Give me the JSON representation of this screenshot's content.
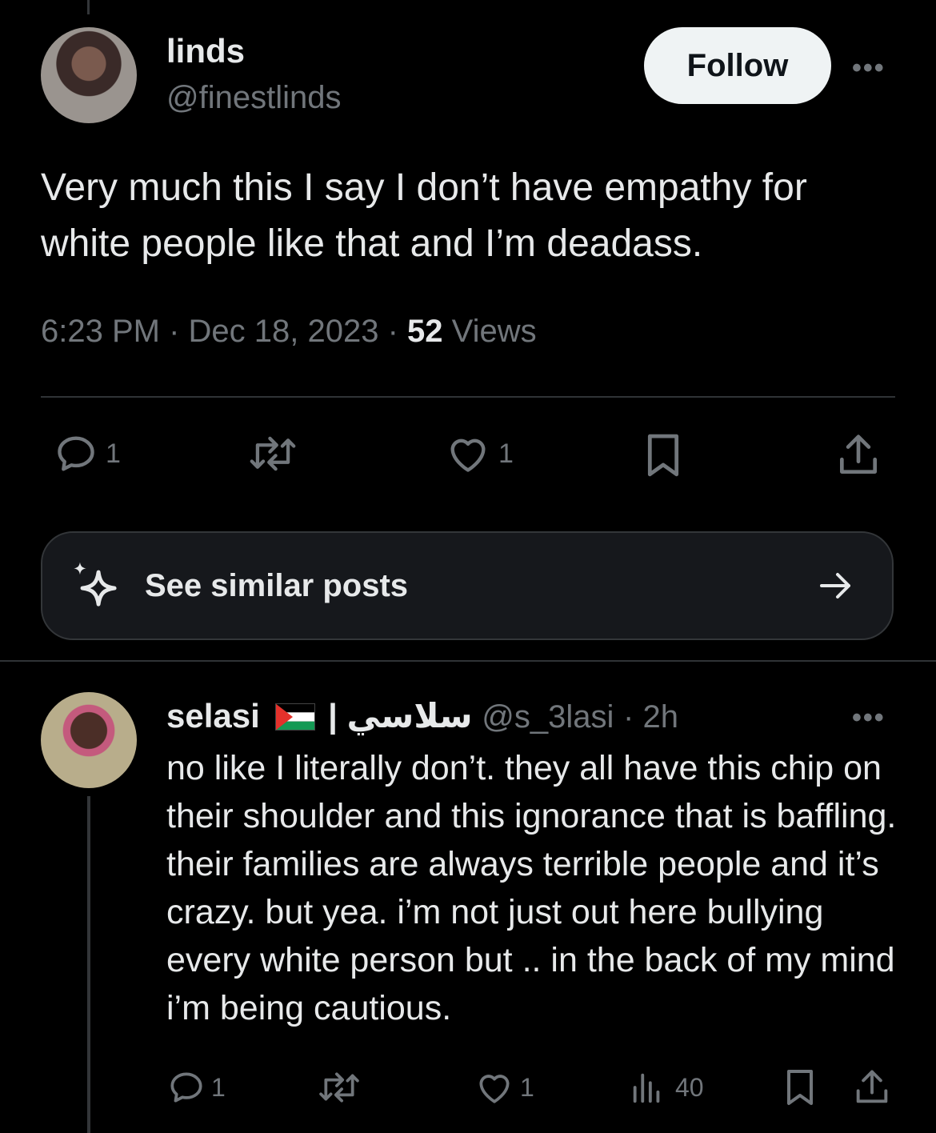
{
  "main_post": {
    "display_name": "linds",
    "handle": "@finestlinds",
    "follow_label": "Follow",
    "more_label": "•••",
    "text": "Very much this I say I don’t have empathy for white people like that and I’m deadass.",
    "time": "6:23 PM",
    "date": "Dec 18, 2023",
    "views_count": "52",
    "views_label": "Views",
    "reply_count": "1",
    "like_count": "1"
  },
  "similar_posts": {
    "label": "See similar posts"
  },
  "reply": {
    "display_name": "selasi",
    "name_suffix": "| سلاسي",
    "handle": "@s_3lasi",
    "time": "2h",
    "more_label": "•••",
    "text": "no like I literally don’t. they all have this chip on their shoulder and this ignorance that is baffling. their families are always terrible people and it’s crazy. but yea. i’m not just out here bullying every white person but .. in the back of my mind i’m being cautious.",
    "reply_count": "1",
    "like_count": "1",
    "views_count": "40"
  },
  "colors": {
    "background": "#000000",
    "text": "#e7e9ea",
    "muted": "#71767b",
    "divider": "#2f3336",
    "follow_bg": "#eff3f4"
  },
  "icons": [
    "reply-icon",
    "repost-icon",
    "like-icon",
    "bookmark-icon",
    "share-icon",
    "sparkle-icon",
    "arrow-right-icon",
    "views-icon",
    "palestine-flag-icon"
  ]
}
